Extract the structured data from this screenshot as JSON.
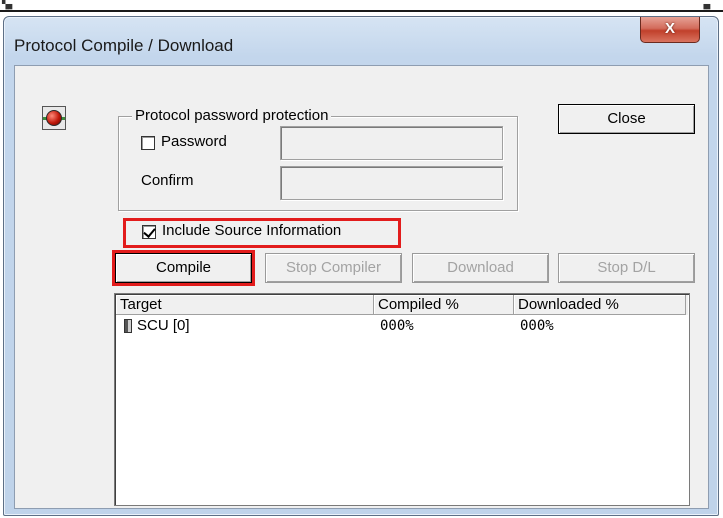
{
  "window": {
    "title": "Protocol Compile / Download",
    "close_glyph": "X",
    "status_icon": "red-led-icon"
  },
  "password_group": {
    "legend": "Protocol password protection",
    "password_label": "Password",
    "password_checked": false,
    "password_value": "",
    "confirm_label": "Confirm",
    "confirm_value": ""
  },
  "include_source": {
    "label": "Include Source Information",
    "checked": true
  },
  "buttons": {
    "close": "Close",
    "compile": "Compile",
    "stop_compiler": "Stop Compiler",
    "download": "Download",
    "stop_download": "Stop D/L"
  },
  "list": {
    "columns": [
      "Target",
      "Compiled %",
      "Downloaded %"
    ],
    "rows": [
      {
        "icon": "device-icon",
        "target": "SCU [0]",
        "compiled": "000%",
        "downloaded": "000%"
      }
    ]
  },
  "colors": {
    "highlight": "#e21c1c",
    "client_bg": "#f0f0f0",
    "title_close_red": "#c1402b"
  }
}
